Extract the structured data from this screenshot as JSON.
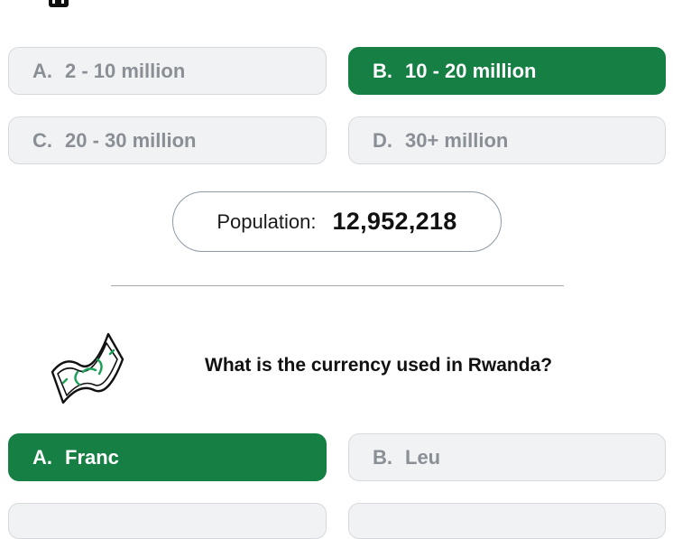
{
  "quiz1": {
    "options": [
      {
        "letter": "A.",
        "text": "2 - 10 million",
        "state": "neutral"
      },
      {
        "letter": "B.",
        "text": "10 - 20 million",
        "state": "correct"
      },
      {
        "letter": "C.",
        "text": "20 - 30 million",
        "state": "neutral"
      },
      {
        "letter": "D.",
        "text": "30+ million",
        "state": "neutral"
      }
    ],
    "result": {
      "label": "Population:",
      "value": "12,952,218"
    }
  },
  "quiz2": {
    "icon": "banknote-icon",
    "question": "What is the currency used in Rwanda?",
    "options": [
      {
        "letter": "A.",
        "text": "Franc",
        "state": "correct"
      },
      {
        "letter": "B.",
        "text": "Leu",
        "state": "neutral"
      }
    ]
  },
  "colors": {
    "correct": "#157f44",
    "neutral_bg": "#f1f2f4",
    "neutral_text": "#8a8f96"
  }
}
